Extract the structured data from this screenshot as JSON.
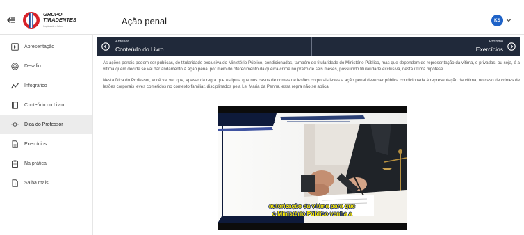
{
  "header": {
    "back_icon": "back-arrow-icon",
    "logo": {
      "line1": "GRUPO",
      "line2": "TIRADENTES",
      "tagline": "Inspirando o futuro"
    },
    "title": "Ação penal",
    "user_initials": "KS"
  },
  "sidebar": {
    "items": [
      {
        "label": "Apresentação",
        "icon": "play-square-icon",
        "active": false
      },
      {
        "label": "Desafio",
        "icon": "spiral-icon",
        "active": false
      },
      {
        "label": "Infográfico",
        "icon": "zigzag-chart-icon",
        "active": false
      },
      {
        "label": "Conteúdo do Livro",
        "icon": "book-icon",
        "active": false
      },
      {
        "label": "Dica do Professor",
        "icon": "lightbulb-icon",
        "active": true
      },
      {
        "label": "Exercícios",
        "icon": "document-icon",
        "active": false
      },
      {
        "label": "Na prática",
        "icon": "clipboard-icon",
        "active": false
      },
      {
        "label": "Saiba mais",
        "icon": "document-plus-icon",
        "active": false
      }
    ]
  },
  "nav": {
    "prev_small": "Anterior",
    "prev_title": "Conteúdo do Livro",
    "next_small": "Próximo",
    "next_title": "Exercícios"
  },
  "content": {
    "p1": "As ações penais podem ser públicas, de titularidade exclusiva do Ministério Público, condicionadas, também de titularidade do Ministério Público, mas que dependem de representação da vítima, e privadas, ou seja, é a vítima quem decide se vai dar andamento à ação penal por meio do oferecimento da queixa-crime no prazo de seis meses, possuindo titularidade exclusiva, nesta última hipótese.",
    "p2": "Nesta Dica do Professor, você vai ver que, apesar da regra que estipula que nos casos de crimes de lesões corporais leves a ação penal deve ser pública condicionada à representação da vítima, no caso de crimes de lesões corporais leves cometidos no contexto familiar, disciplinados pela Lei Maria da Penha, essa regra não se aplica."
  },
  "video": {
    "subtitle_line1": "autorização da vítima para que",
    "subtitle_line2": "o Ministério Público venha a"
  },
  "colors": {
    "nav_bg": "#20293a",
    "avatar": "#1f63c8",
    "logo_red": "#d8232a",
    "logo_blue": "#1d4f9c",
    "subtitle": "#ffee00"
  }
}
